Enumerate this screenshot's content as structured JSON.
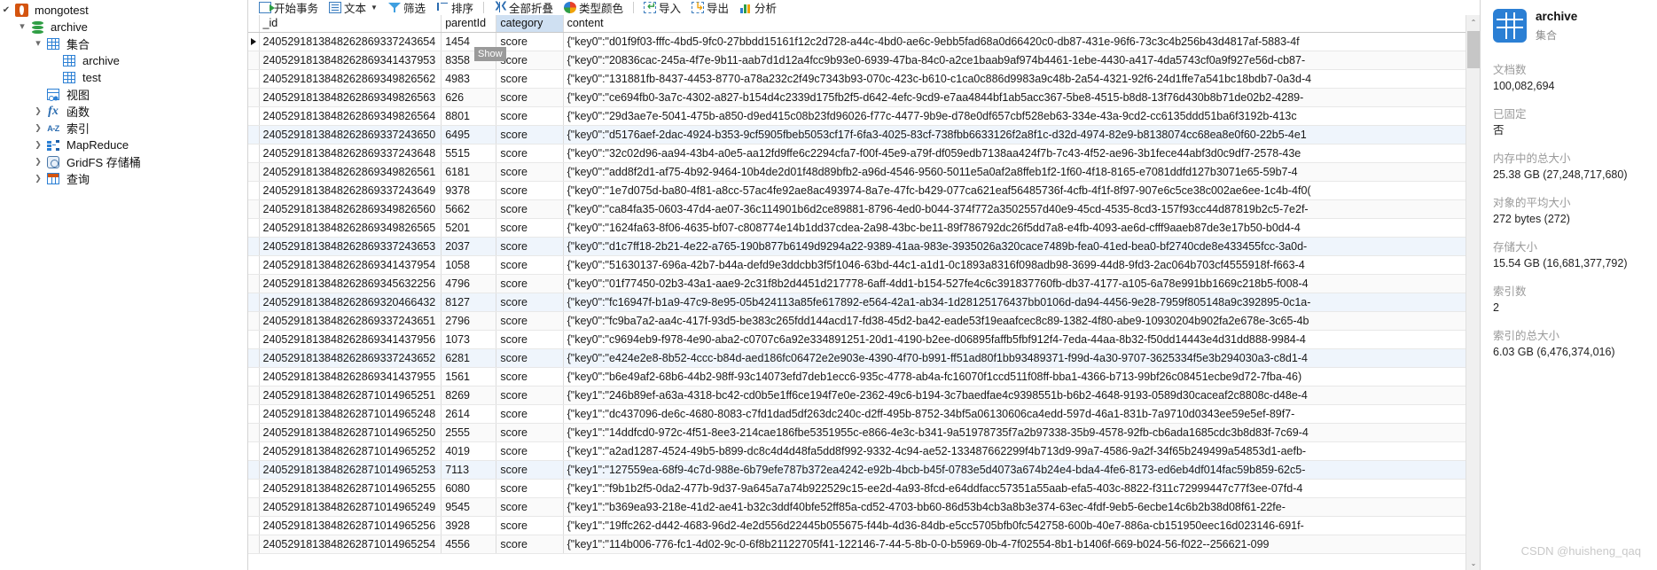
{
  "toolbar": {
    "items": [
      {
        "label": "开始事务",
        "icon": "transaction-icon",
        "caret": false
      },
      {
        "label": "文本",
        "icon": "text-doc-icon",
        "caret": true
      },
      {
        "label": "筛选",
        "icon": "filter-funnel-icon",
        "caret": false
      },
      {
        "label": "排序",
        "icon": "sort-icon",
        "caret": false
      },
      {
        "label": "全部折叠",
        "icon": "collapse-all-icon",
        "caret": false
      },
      {
        "label": "类型颜色",
        "icon": "type-color-wheel-icon",
        "caret": false
      },
      {
        "label": "导入",
        "icon": "import-icon",
        "caret": false
      },
      {
        "label": "导出",
        "icon": "export-icon",
        "caret": false
      },
      {
        "label": "分析",
        "icon": "analyze-icon",
        "caret": false
      }
    ]
  },
  "sidebar": {
    "items": [
      {
        "label": "mongotest",
        "icon": "mongodb-leaf-icon",
        "indent": 0,
        "twisty": "check"
      },
      {
        "label": "archive",
        "icon": "database-icon",
        "indent": 1,
        "twisty": "down"
      },
      {
        "label": "集合",
        "icon": "collections-grid-icon",
        "indent": 2,
        "twisty": "down"
      },
      {
        "label": "archive",
        "icon": "collection-grid-icon",
        "indent": 3,
        "twisty": "none"
      },
      {
        "label": "test",
        "icon": "collection-grid-icon",
        "indent": 3,
        "twisty": "none"
      },
      {
        "label": "视图",
        "icon": "views-icon",
        "indent": 2,
        "twisty": "none"
      },
      {
        "label": "函数",
        "icon": "functions-fx-icon",
        "indent": 2,
        "twisty": "right"
      },
      {
        "label": "索引",
        "icon": "index-az-icon",
        "indent": 2,
        "twisty": "right"
      },
      {
        "label": "MapReduce",
        "icon": "mapreduce-icon",
        "indent": 2,
        "twisty": "right"
      },
      {
        "label": "GridFS 存储桶",
        "icon": "gridfs-bucket-icon",
        "indent": 2,
        "twisty": "right"
      },
      {
        "label": "查询",
        "icon": "queries-icon",
        "indent": 2,
        "twisty": "right"
      }
    ]
  },
  "grid": {
    "show_tag": "Show",
    "columns": [
      {
        "key": "_id",
        "label": "_id",
        "selected": false
      },
      {
        "key": "parentId",
        "label": "parentId",
        "selected": false
      },
      {
        "key": "category",
        "label": "category",
        "selected": true
      },
      {
        "key": "content",
        "label": "content",
        "selected": false
      }
    ],
    "rows": [
      {
        "_id": "2405291813848262869337243654",
        "parentId": "1454",
        "category": "score",
        "content": "{\"key0\":\"d01f9f03-fffc-4bd5-9fc0-27bbdd15161f12c2d728-a44c-4bd0-ae6c-9ebb5fad68a0d66420c0-db87-431e-96f6-73c3c4b256b43d4817af-5883-4f"
      },
      {
        "_id": "2405291813848262869341437953",
        "parentId": "8358",
        "category": "score",
        "content": "{\"key0\":\"20836cac-245a-4f7e-9b11-aab7d1d12a4fcc9b93e0-6939-47ba-84c0-a2ce1baab9af974b4461-1ebe-4430-a417-4da5743cf0a9f927e56d-cb87-"
      },
      {
        "_id": "2405291813848262869349826562",
        "parentId": "4983",
        "category": "score",
        "content": "{\"key0\":\"131881fb-8437-4453-8770-a78a232c2f49c7343b93-070c-423c-b610-c1ca0c886d9983a9c48b-2a54-4321-92f6-24d1ffe7a541bc18bdb7-0a3d-4"
      },
      {
        "_id": "2405291813848262869349826563",
        "parentId": "626",
        "category": "score",
        "content": "{\"key0\":\"ce694fb0-3a7c-4302-a827-b154d4c2339d175fb2f5-d642-4efc-9cd9-e7aa4844bf1ab5acc367-5be8-4515-b8d8-13f76d430b8b71de02b2-4289-"
      },
      {
        "_id": "2405291813848262869349826564",
        "parentId": "8801",
        "category": "score",
        "content": "{\"key0\":\"29d3ae7e-5041-475b-a850-d9ed415c08b23fd96026-f77c-4477-9b9e-d78e0df657cbf528eb63-334e-43a-9cd2-cc6135ddd51ba6f3192b-413c"
      },
      {
        "_id": "2405291813848262869337243650",
        "parentId": "6495",
        "category": "score",
        "content": "{\"key0\":\"d5176aef-2dac-4924-b353-9cf5905fbeb5053cf17f-6fa3-4025-83cf-738fbb6633126f2a8f1c-d32d-4974-82e9-b8138074cc68ea8e0f60-22b5-4e1"
      },
      {
        "_id": "2405291813848262869337243648",
        "parentId": "5515",
        "category": "score",
        "content": "{\"key0\":\"32c02d96-aa94-43b4-a0e5-aa12fd9ffe6c2294cfa7-f00f-45e9-a79f-df059edb7138aa424f7b-7c43-4f52-ae96-3b1fece44abf3d0c9df7-2578-43e"
      },
      {
        "_id": "2405291813848262869349826561",
        "parentId": "6181",
        "category": "score",
        "content": "{\"key0\":\"add8f2d1-af75-4b92-9464-10b4de2d01f48d89bfb2-a96d-4546-9560-5011e5a0af2a8ffeb1f2-1f60-4f18-8165-e7081ddfd127b3071e65-59b7-4"
      },
      {
        "_id": "2405291813848262869337243649",
        "parentId": "9378",
        "category": "score",
        "content": "{\"key0\":\"1e7d075d-ba80-4f81-a8cc-57ac4fe92ae8ac493974-8a7e-47fc-b429-077ca621eaf56485736f-4cfb-4f1f-8f97-907e6c5ce38c002ae6ee-1c4b-4f0("
      },
      {
        "_id": "2405291813848262869349826560",
        "parentId": "5662",
        "category": "score",
        "content": "{\"key0\":\"ca84fa35-0603-47d4-ae07-36c114901b6d2ce89881-8796-4ed0-b044-374f772a3502557d40e9-45cd-4535-8cd3-157f93cc44d87819b2c5-7e2f-"
      },
      {
        "_id": "2405291813848262869349826565",
        "parentId": "5201",
        "category": "score",
        "content": "{\"key0\":\"1624fa63-8f06-4635-bf07-c808774e14b1dd37cdea-2a98-43bc-be11-89f786792dc26f5dd7a8-e4fb-4093-ae6d-cfff9aaeb87de3e17b50-b0d4-4"
      },
      {
        "_id": "2405291813848262869337243653",
        "parentId": "2037",
        "category": "score",
        "content": "{\"key0\":\"d1c7ff18-2b21-4e22-a765-190b877b6149d9294a22-9389-41aa-983e-3935026a320cace7489b-fea0-41ed-bea0-bf2740cde8e433455fcc-3a0d-"
      },
      {
        "_id": "2405291813848262869341437954",
        "parentId": "1058",
        "category": "score",
        "content": "{\"key0\":\"51630137-696a-42b7-b44a-defd9e3ddcbb3f5f1046-63bd-44c1-a1d1-0c1893a8316f098adb98-3699-44d8-9fd3-2ac064b703cf4555918f-f663-4"
      },
      {
        "_id": "2405291813848262869345632256",
        "parentId": "4796",
        "category": "score",
        "content": "{\"key0\":\"01f77450-02b3-43a1-aae9-2c31f8b2d4451d217778-6aff-4dd1-b154-527fe4c6c391837760fb-db37-4177-a105-6a78e991bb1669c218b5-f008-4"
      },
      {
        "_id": "2405291813848262869320466432",
        "parentId": "8127",
        "category": "score",
        "content": "{\"key0\":\"fc16947f-b1a9-47c9-8e95-05b424113a85fe617892-e564-42a1-ab34-1d28125176437bb0106d-da94-4456-9e28-7959f805148a9c392895-0c1a-"
      },
      {
        "_id": "2405291813848262869337243651",
        "parentId": "2796",
        "category": "score",
        "content": "{\"key0\":\"fc9ba7a2-aa4c-417f-93d5-be383c265fdd144acd17-fd38-45d2-ba42-eade53f19eaafcec8c89-1382-4f80-abe9-10930204b902fa2e678e-3c65-4b"
      },
      {
        "_id": "2405291813848262869341437956",
        "parentId": "1073",
        "category": "score",
        "content": "{\"key0\":\"c9694eb9-f978-4e90-aba2-c0707c6a92e334891251-20d1-4190-b2ee-d06895faffb5fbf912f4-7eda-44aa-8b32-f50dd14443e4d31dd888-9984-4"
      },
      {
        "_id": "2405291813848262869337243652",
        "parentId": "6281",
        "category": "score",
        "content": "{\"key0\":\"e424e2e8-8b52-4ccc-b84d-aed186fc06472e2e903e-4390-4f70-b991-ff51ad80f1bb93489371-f99d-4a30-9707-3625334f5e3b294030a3-c8d1-4"
      },
      {
        "_id": "2405291813848262869341437955",
        "parentId": "1561",
        "category": "score",
        "content": "{\"key0\":\"b6e49af2-68b6-44b2-98ff-93c14073efd7deb1ecc6-935c-4778-ab4a-fc16070f1ccd511f08ff-bba1-4366-b713-99bf26c08451ecbe9d72-7fba-46)"
      },
      {
        "_id": "2405291813848262871014965251",
        "parentId": "8269",
        "category": "score",
        "content": "{\"key1\":\"246b89ef-a63a-4318-bc42-cd0b5e1ff6ce194f7e0e-2362-49c6-b194-3c7baedfae4c9398551b-b6b2-4648-9193-0589d30caceaf2c8808c-d48e-4"
      },
      {
        "_id": "2405291813848262871014965248",
        "parentId": "2614",
        "category": "score",
        "content": "{\"key1\":\"dc437096-de6c-4680-8083-c7fd1dad5df263dc240c-d2ff-495b-8752-34bf5a06130606ca4edd-597d-46a1-831b-7a9710d0343ee59e5ef-89f7-"
      },
      {
        "_id": "2405291813848262871014965250",
        "parentId": "2555",
        "category": "score",
        "content": "{\"key1\":\"14ddfcd0-972c-4f51-8ee3-214cae186fbe5351955c-e866-4e3c-b341-9a51978735f7a2b97338-35b9-4578-92fb-cb6ada1685cdc3b8d83f-7c69-4"
      },
      {
        "_id": "2405291813848262871014965252",
        "parentId": "4019",
        "category": "score",
        "content": "{\"key1\":\"a2ad1287-4524-49b5-b899-dc8c4d4d48fa5dd8f992-9332-4c94-ae52-133487662299f4b713d9-99a7-4586-9a2f-34f65b249499a54853d1-aefb-"
      },
      {
        "_id": "2405291813848262871014965253",
        "parentId": "7113",
        "category": "score",
        "content": "{\"key1\":\"127559ea-68f9-4c7d-988e-6b79efe787b372ea4242-e92b-4bcb-b45f-0783e5d4073a674b24e4-bda4-4fe6-8173-ed6eb4df014fac59b859-62c5-"
      },
      {
        "_id": "2405291813848262871014965255",
        "parentId": "6080",
        "category": "score",
        "content": "{\"key1\":\"f9b1b2f5-0da2-477b-9d37-9a645a7a74b922529c15-ee2d-4a93-8fcd-e64ddfacc57351a55aab-efa5-403c-8822-f311c72999447c77f3ee-07fd-4"
      },
      {
        "_id": "2405291813848262871014965249",
        "parentId": "9545",
        "category": "score",
        "content": "{\"key1\":\"b369ea93-218e-41d2-ae41-b32c3ddf40bfe52ff85a-cd52-4703-bb60-86d53b4cb3a8b3e374-63ec-4fdf-9eb5-6ecbe14c6b2b38d08f61-22fe-"
      },
      {
        "_id": "2405291813848262871014965256",
        "parentId": "3928",
        "category": "score",
        "content": "{\"key1\":\"19ffc262-d442-4683-96d2-4e2d556d22445b055675-f44b-4d36-84db-e5cc5705bfb0fc542758-600b-40e7-886a-cb151950eec16d023146-691f-"
      },
      {
        "_id": "2405291813848262871014965254",
        "parentId": "4556",
        "category": "score",
        "content": "{\"key1\":\"114b006-776-fc1-4d02-9c-0-6f8b21122705f41-122146-7-44-5-8b-0-0-b5969-0b-4-7f02554-8b1-b1406f-669-b024-56-f022--256621-099"
      }
    ]
  },
  "right_panel": {
    "title": "archive",
    "subtitle": "集合",
    "fields": [
      {
        "label": "文档数",
        "value": "100,082,694"
      },
      {
        "label": "已固定",
        "value": "否"
      },
      {
        "label": "内存中的总大小",
        "value": "25.38 GB (27,248,717,680)"
      },
      {
        "label": "对象的平均大小",
        "value": "272 bytes (272)"
      },
      {
        "label": "存储大小",
        "value": "15.54 GB (16,681,377,792)"
      },
      {
        "label": "索引数",
        "value": "2"
      },
      {
        "label": "索引的总大小",
        "value": "6.03 GB (6,476,374,016)"
      }
    ]
  },
  "watermark": "CSDN @huisheng_qaq",
  "scrollbar": {
    "up": "⌃",
    "down": "⌄"
  },
  "colors": {
    "accent": "#2b7fd4",
    "header_selected": "#cfe0f2",
    "row_highlight": "#eff5fc",
    "mongo_orange": "#d4540f",
    "db_green": "#2f9e44"
  }
}
